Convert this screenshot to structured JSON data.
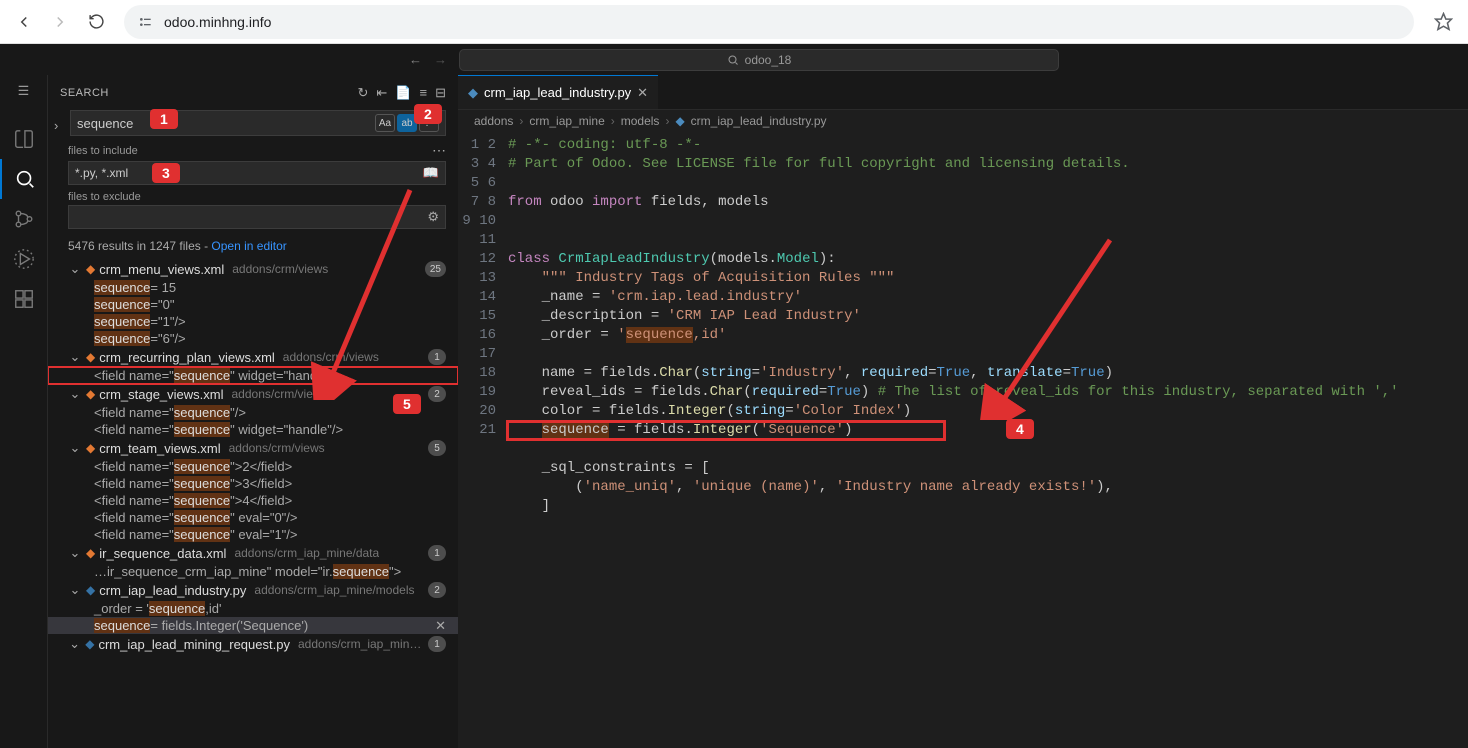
{
  "browser": {
    "url": "odoo.minhng.info"
  },
  "titleSearch": {
    "text": "odoo_18"
  },
  "panel": {
    "title": "SEARCH",
    "query": "sequence",
    "filesIncludeLabel": "files to include",
    "filesInclude": "*.py, *.xml",
    "filesExcludeLabel": "files to exclude",
    "filesExclude": "",
    "summaryCount": "5476 results in 1247 files - ",
    "openInEditor": "Open in editor"
  },
  "results": {
    "f0": {
      "name": "crm_menu_views.xml",
      "path": "addons/crm/views",
      "badge": "25",
      "m0": "sequence=\"15\"",
      "m1": "sequence=\"0\"",
      "m2": "sequence=\"1\"/>",
      "m3": "sequence=\"6\"/>"
    },
    "f1": {
      "name": "crm_recurring_plan_views.xml",
      "path": "addons/crm/views",
      "badge": "1",
      "m0": "<field name=\"sequence\" widget=\"handle\"/>"
    },
    "f2": {
      "name": "crm_stage_views.xml",
      "path": "addons/crm/views",
      "badge": "2",
      "m0": "<field name=\"sequence\"/>",
      "m1": "<field name=\"sequence\" widget=\"handle\"/>"
    },
    "f3": {
      "name": "crm_team_views.xml",
      "path": "addons/crm/views",
      "badge": "5",
      "m0": "<field name=\"sequence\">2</field>",
      "m1": "<field name=\"sequence\">3</field>",
      "m2": "<field name=\"sequence\">4</field>",
      "m3": "<field name=\"sequence\" eval=\"0\"/>",
      "m4": "<field name=\"sequence\" eval=\"1\"/>"
    },
    "f4": {
      "name": "ir_sequence_data.xml",
      "path": "addons/crm_iap_mine/data",
      "badge": "1",
      "m0": "…ir_sequence_crm_iap_mine\" model=\"ir.sequence\">"
    },
    "f5": {
      "name": "crm_iap_lead_industry.py",
      "path": "addons/crm_iap_mine/models",
      "badge": "2",
      "m0": "_order = 'sequence,id'",
      "m1": "sequence = fields.Integer('Sequence')"
    },
    "f6": {
      "name": "crm_iap_lead_mining_request.py",
      "path": "addons/crm_iap_mine/…",
      "badge": "1"
    }
  },
  "tab": {
    "name": "crm_iap_lead_industry.py"
  },
  "crumbs": {
    "c0": "addons",
    "c1": "crm_iap_mine",
    "c2": "models",
    "c3": "crm_iap_lead_industry.py"
  },
  "anno": {
    "a1": "1",
    "a2": "2",
    "a3": "3",
    "a4": "4",
    "a5": "5"
  },
  "code": {
    "l1a": "# -*- coding: utf-8 -*-",
    "l2a": "# Part of Odoo. See LICENSE file for full copyright and licensing details.",
    "l4_from": "from",
    "l4_odoo": " odoo ",
    "l4_import": "import",
    "l4_rest": " fields, models",
    "l7_class": "class",
    "l7_name": " CrmIapLeadIndustry",
    "l7_p1": "(models",
    "l7_p2": ".",
    "l7_model": "Model",
    "l7_p3": "):",
    "l8": "    \"\"\" Industry Tags of Acquisition Rules \"\"\"",
    "l9a": "    _name = ",
    "l9b": "'crm.iap.lead.industry'",
    "l10a": "    _description = ",
    "l10b": "'CRM IAP Lead Industry'",
    "l11a": "    _order = ",
    "l11b": "'",
    "l11hl": "sequence",
    "l11c": ",id'",
    "l13a": "    name = fields.",
    "l13b": "Char",
    "l13c": "(",
    "l13d": "string",
    "l13e": "=",
    "l13f": "'Industry'",
    "l13g": ", ",
    "l13h": "required",
    "l13i": "=",
    "l13j": "True",
    "l13k": ", ",
    "l13l": "translate",
    "l13m": "=",
    "l13n": "True",
    "l13o": ")",
    "l14a": "    reveal_ids = fields.",
    "l14b": "Char",
    "l14c": "(",
    "l14d": "required",
    "l14e": "=",
    "l14f": "True",
    "l14g": ") ",
    "l14h": "# The list of reveal_ids for this industry, separated with ','",
    "l15a": "    color = fields.",
    "l15b": "Integer",
    "l15c": "(",
    "l15d": "string",
    "l15e": "=",
    "l15f": "'Color Index'",
    "l15g": ")",
    "l16a": "    ",
    "l16hl": "sequence",
    "l16b": " = fields.",
    "l16c": "Integer",
    "l16d": "(",
    "l16e": "'Sequence'",
    "l16f": ")",
    "l18a": "    _sql_constraints = [",
    "l19a": "        (",
    "l19b": "'name_uniq'",
    "l19c": ", ",
    "l19d": "'unique (name)'",
    "l19e": ", ",
    "l19f": "'Industry name already exists!'",
    "l19g": "),",
    "l20a": "    ]"
  }
}
